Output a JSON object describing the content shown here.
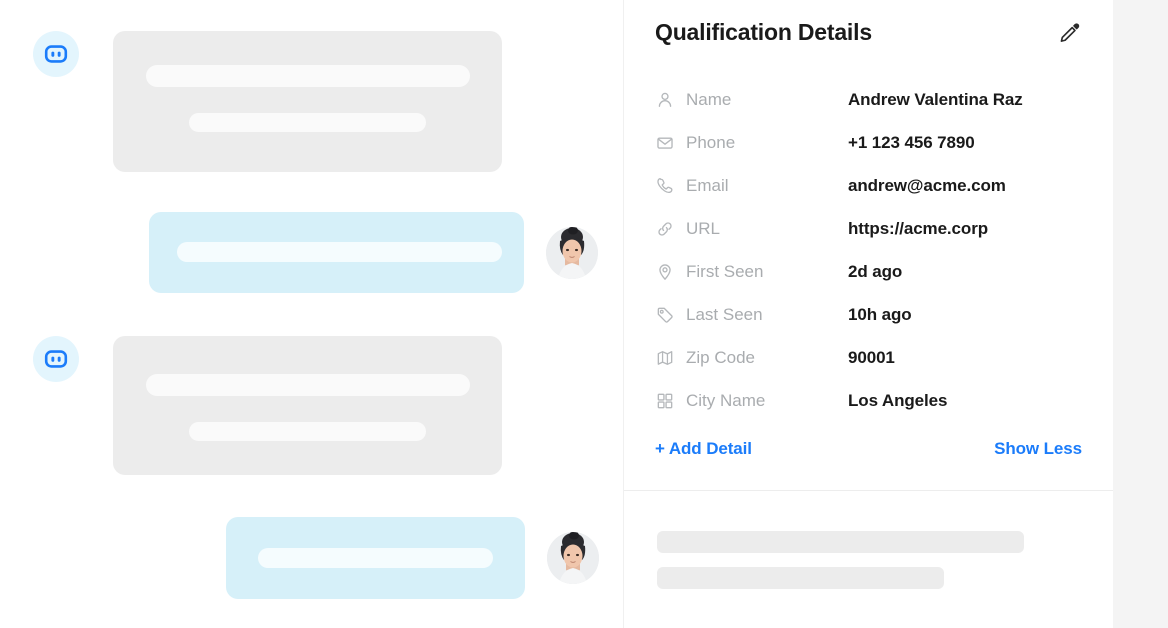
{
  "colors": {
    "page_background": "#ffffff",
    "right_strip": "#f4f4f4",
    "bot_bubble": "#ececec",
    "bot_bubble_skeleton": "#fafafa",
    "user_bubble": "#d6f0f9",
    "user_bubble_skeleton": "#f5fcfe",
    "bot_avatar_background": "#e3f5fd",
    "bot_avatar_accent": "#1b7cfa",
    "label_text": "#a9acaf",
    "value_text": "#1a1a1a",
    "link_accent": "#1b7cfa",
    "divider": "#ededed",
    "panel_skeleton": "#ececec"
  },
  "chat": {
    "messages": [
      {
        "id": "bot-message-1",
        "sender": "bot",
        "avatar_icon": "robot-icon",
        "content_state": "loading"
      },
      {
        "id": "user-message-1",
        "sender": "user",
        "avatar_icon": "user-photo-avatar",
        "content_state": "loading"
      },
      {
        "id": "bot-message-2",
        "sender": "bot",
        "avatar_icon": "robot-icon",
        "content_state": "loading"
      },
      {
        "id": "user-message-2",
        "sender": "user",
        "avatar_icon": "user-photo-avatar",
        "content_state": "loading"
      }
    ]
  },
  "details": {
    "title": "Qualification Details",
    "edit_icon": "pencil-icon",
    "rows": [
      {
        "icon": "person-icon",
        "label": "Name",
        "value": "Andrew Valentina Raz"
      },
      {
        "icon": "envelope-icon",
        "label": "Phone",
        "value": "+1 123 456 7890"
      },
      {
        "icon": "phone-icon",
        "label": "Email",
        "value": "andrew@acme.com"
      },
      {
        "icon": "link-icon",
        "label": "URL",
        "value": "https://acme.corp"
      },
      {
        "icon": "map-pin-icon",
        "label": "First Seen",
        "value": "2d ago"
      },
      {
        "icon": "tag-icon",
        "label": "Last Seen",
        "value": "10h ago"
      },
      {
        "icon": "map-icon",
        "label": "Zip Code",
        "value": "90001"
      },
      {
        "icon": "grid-icon",
        "label": "City Name",
        "value": "Los Angeles"
      }
    ],
    "actions": {
      "add_detail_label": "+ Add Detail",
      "show_less_label": "Show Less"
    }
  }
}
